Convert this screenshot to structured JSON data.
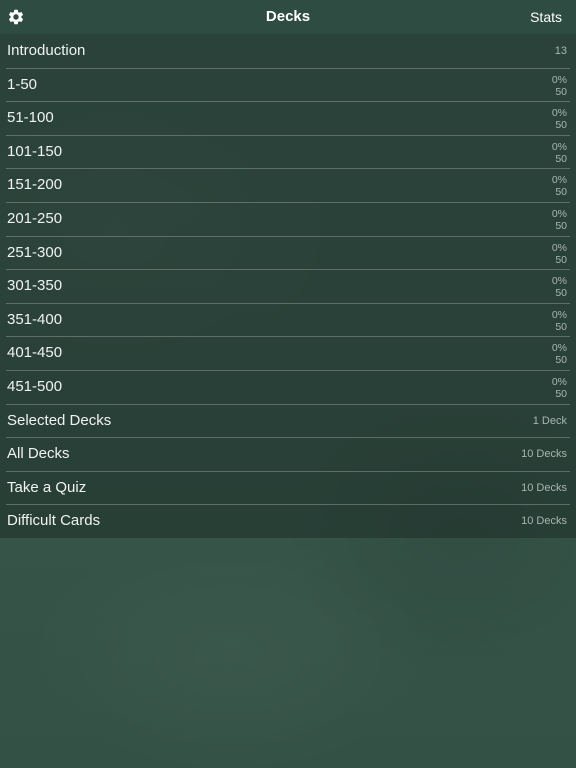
{
  "navbar": {
    "title": "Decks",
    "stats_label": "Stats",
    "settings_icon": "gear-icon"
  },
  "decks": [
    {
      "label": "Introduction",
      "detail": "13"
    },
    {
      "label": "1-50",
      "progress": "0%",
      "count": "50"
    },
    {
      "label": "51-100",
      "progress": "0%",
      "count": "50"
    },
    {
      "label": "101-150",
      "progress": "0%",
      "count": "50"
    },
    {
      "label": "151-200",
      "progress": "0%",
      "count": "50"
    },
    {
      "label": "201-250",
      "progress": "0%",
      "count": "50"
    },
    {
      "label": "251-300",
      "progress": "0%",
      "count": "50"
    },
    {
      "label": "301-350",
      "progress": "0%",
      "count": "50"
    },
    {
      "label": "351-400",
      "progress": "0%",
      "count": "50"
    },
    {
      "label": "401-450",
      "progress": "0%",
      "count": "50"
    },
    {
      "label": "451-500",
      "progress": "0%",
      "count": "50"
    }
  ],
  "options": [
    {
      "label": "Selected Decks",
      "detail": "1 Deck"
    },
    {
      "label": "All Decks",
      "detail": "10 Decks"
    },
    {
      "label": "Take a Quiz",
      "detail": "10 Decks"
    },
    {
      "label": "Difficult Cards",
      "detail": "10 Decks"
    }
  ],
  "colors": {
    "background": "#37544a",
    "list_background": "#1e302a",
    "text": "#ffffff",
    "secondary_text": "#a9b6b0"
  }
}
